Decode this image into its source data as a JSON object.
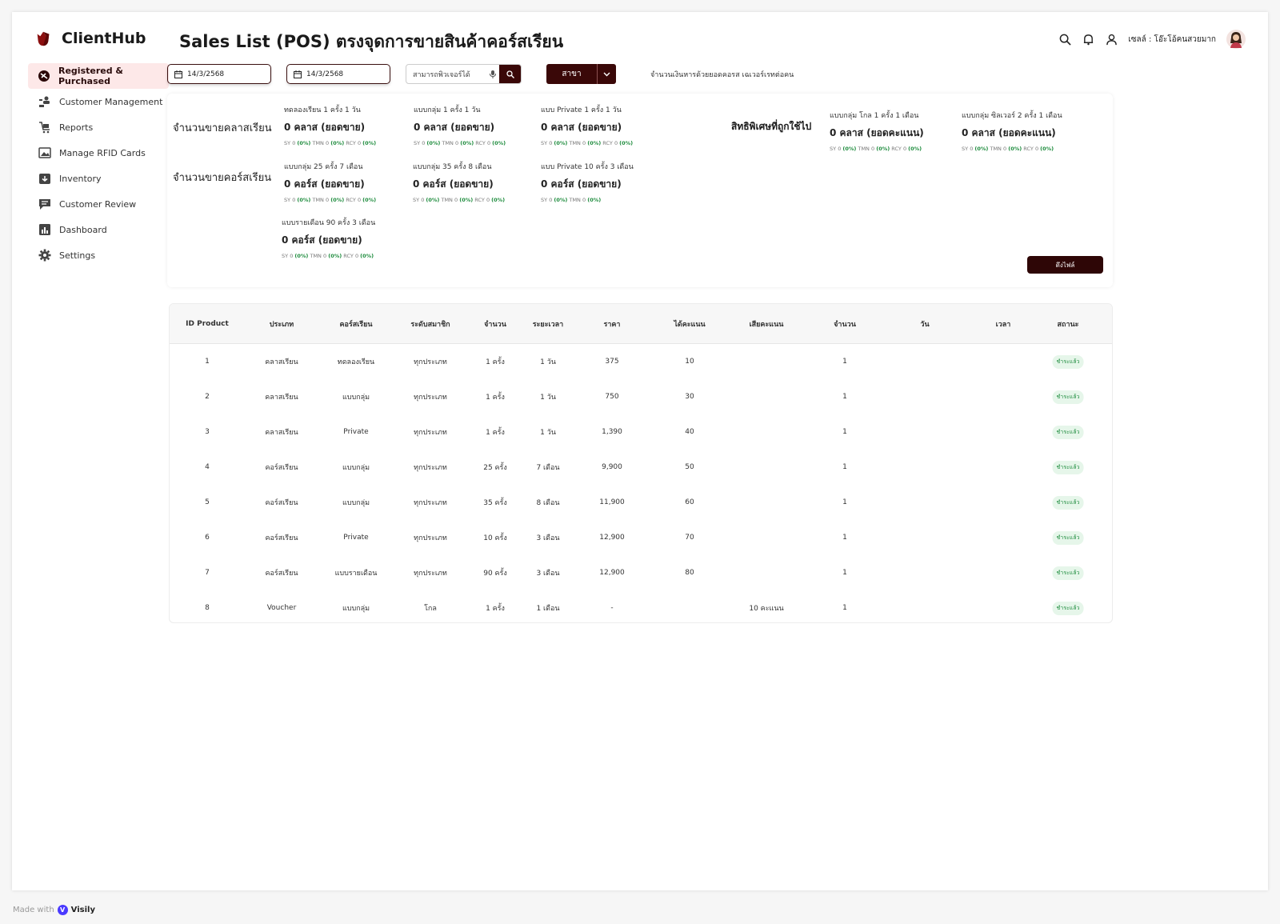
{
  "app": {
    "name": "ClientHub"
  },
  "page": {
    "title": "Sales List (POS) ตรงจุดการขายสินค้าคอร์สเรียน"
  },
  "nav": [
    {
      "label": "Registered & Purchased",
      "icon": "registered-icon",
      "active": true
    },
    {
      "label": "Customer Management",
      "icon": "users-icon",
      "active": false
    },
    {
      "label": "Reports",
      "icon": "reports-icon",
      "active": false
    },
    {
      "label": "Manage RFID Cards",
      "icon": "image-icon",
      "active": false
    },
    {
      "label": "Inventory",
      "icon": "inventory-icon",
      "active": false
    },
    {
      "label": "Customer Review",
      "icon": "review-icon",
      "active": false
    },
    {
      "label": "Dashboard",
      "icon": "dashboard-icon",
      "active": false
    },
    {
      "label": "Settings",
      "icon": "gear-icon",
      "active": false
    }
  ],
  "user": {
    "name": "เซลล์ : โอ๊ะโอ้คนสวยมาก"
  },
  "filters": {
    "date_from": "14/3/2568",
    "date_to": "14/3/2568",
    "search_placeholder": "สามารถพิวเจอร์ได้",
    "branch_label": "สาขา",
    "note": "จำนวนเงินหารด้วยยอดคอรส เฉเวอร์เรทต่อคน"
  },
  "summary": {
    "class_label": "จำนวนขายคลาสเรียน",
    "course_label": "จำนวนขายคอร์สเรียน",
    "privilege_label": "สิทธิพิเศษที่ถูกใช้ไป",
    "pull_button": "ดึงไฟล์",
    "class_stats": [
      {
        "caption": "ทดลองเรียน 1 ครั้ง 1 วัน",
        "value": "0 คลาส (ยอดขาย)"
      },
      {
        "caption": "แบบกลุ่ม 1 ครั้ง 1 วัน",
        "value": "0 คลาส (ยอดขาย)"
      },
      {
        "caption": "แบบ Private 1 ครั้ง 1 วัน",
        "value": "0 คลาส (ยอดขาย)"
      }
    ],
    "course_stats": [
      {
        "caption": "แบบกลุ่ม 25 ครั้ง 7 เดือน",
        "value": "0 คอร์ส (ยอดขาย)"
      },
      {
        "caption": "แบบกลุ่ม 35 ครั้ง 8 เดือน",
        "value": "0 คอร์ส (ยอดขาย)"
      },
      {
        "caption": "แบบ Private 10 ครั้ง 3 เดือน",
        "value": "0 คอร์ส (ยอดขาย)"
      },
      {
        "caption": "แบบรายเดือน 90 ครั้ง 3 เดือน",
        "value": "0 คอร์ส (ยอดขาย)"
      }
    ],
    "privilege_stats": [
      {
        "caption": "แบบกลุ่ม โกล 1 ครั้ง 1 เดือน",
        "value": "0 คลาส (ยอดคะแนน)"
      },
      {
        "caption": "แบบกลุ่ม ซิลเวอร์ 2 ครั้ง 1 เดือน",
        "value": "0 คลาส (ยอดคะแนน)"
      }
    ],
    "breakdown": {
      "sy": "SY",
      "tmn": "TMN",
      "rcy": "RCY",
      "count": "0",
      "pct": "(0%)"
    }
  },
  "table": {
    "headers": [
      "ID Product",
      "ประเภท",
      "คอร์สเรียน",
      "ระดับสมาชิก",
      "จำนวน",
      "ระยะเวลา",
      "ราคา",
      "ได้คะแนน",
      "เสียคะแนน",
      "จำนวน",
      "วัน",
      "เวลา",
      "สถานะ"
    ],
    "rows": [
      [
        "1",
        "คลาสเรียน",
        "ทดลองเรียน",
        "ทุกประเภท",
        "1 ครั้ง",
        "1 วัน",
        "375",
        "10",
        "",
        "1",
        "",
        "",
        "ชำระแล้ว"
      ],
      [
        "2",
        "คลาสเรียน",
        "แบบกลุ่ม",
        "ทุกประเภท",
        "1 ครั้ง",
        "1 วัน",
        "750",
        "30",
        "",
        "1",
        "",
        "",
        "ชำระแล้ว"
      ],
      [
        "3",
        "คลาสเรียน",
        "Private",
        "ทุกประเภท",
        "1 ครั้ง",
        "1 วัน",
        "1,390",
        "40",
        "",
        "1",
        "",
        "",
        "ชำระแล้ว"
      ],
      [
        "4",
        "คอร์สเรียน",
        "แบบกลุ่ม",
        "ทุกประเภท",
        "25 ครั้ง",
        "7 เดือน",
        "9,900",
        "50",
        "",
        "1",
        "",
        "",
        "ชำระแล้ว"
      ],
      [
        "5",
        "คอร์สเรียน",
        "แบบกลุ่ม",
        "ทุกประเภท",
        "35 ครั้ง",
        "8 เดือน",
        "11,900",
        "60",
        "",
        "1",
        "",
        "",
        "ชำระแล้ว"
      ],
      [
        "6",
        "คอร์สเรียน",
        "Private",
        "ทุกประเภท",
        "10 ครั้ง",
        "3 เดือน",
        "12,900",
        "70",
        "",
        "1",
        "",
        "",
        "ชำระแล้ว"
      ],
      [
        "7",
        "คอร์สเรียน",
        "แบบรายเดือน",
        "ทุกประเภท",
        "90 ครั้ง",
        "3 เดือน",
        "12,900",
        "80",
        "",
        "1",
        "",
        "",
        "ชำระแล้ว"
      ],
      [
        "8",
        "Voucher",
        "แบบกลุ่ม",
        "โกล",
        "1 ครั้ง",
        "1 เดือน",
        "-",
        "",
        "10 คะแนน",
        "1",
        "",
        "",
        "ชำระแล้ว"
      ]
    ]
  },
  "footer": {
    "made_with": "Made with",
    "brand": "Visily"
  },
  "colors": {
    "primary": "#3a0808",
    "active_bg": "#fde8e8",
    "success": "#1a8a3a"
  }
}
